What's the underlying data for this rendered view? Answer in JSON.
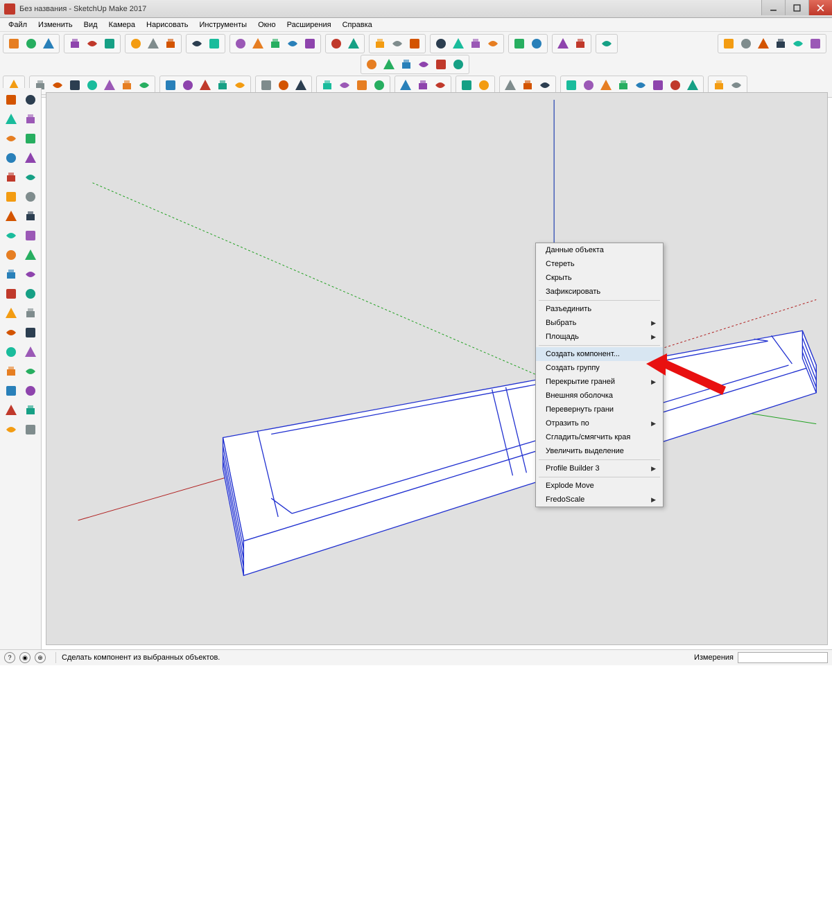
{
  "title": "Без названия - SketchUp Make 2017",
  "menu": [
    "Файл",
    "Изменить",
    "Вид",
    "Камера",
    "Нарисовать",
    "Инструменты",
    "Окно",
    "Расширения",
    "Справка"
  ],
  "toolbars": {
    "row1": {
      "g1": [
        "new-file",
        "open-file",
        "save-file"
      ],
      "g2": [
        "cut",
        "copy",
        "paste"
      ],
      "g3": [
        "delete",
        "undo",
        "redo"
      ],
      "g4": [
        "print",
        "model-info"
      ],
      "g5": [
        "component-a",
        "component-b",
        "component-c",
        "component-d",
        "component-e"
      ],
      "g6": [
        "layer-a",
        "layer-b"
      ],
      "g7": [
        "style-a",
        "style-b",
        "style-c"
      ],
      "g8": [
        "nav-a",
        "nav-b",
        "nav-c",
        "nav-d"
      ],
      "g9": [
        "misc-a",
        "misc-b"
      ],
      "g10": [
        "curve-a",
        "curve-b"
      ],
      "g11": [
        "plugin-a"
      ],
      "gRight": [
        "render-a",
        "render-b",
        "render-c",
        "render-d",
        "render-e",
        "render-f"
      ]
    },
    "row2": [
      "house-a",
      "house-b",
      "house-c",
      "house-d",
      "house-e",
      "house-f"
    ],
    "row3": {
      "g1": [
        "select"
      ],
      "g2": [
        "eraser",
        "pencil",
        "pencil-dd",
        "arc",
        "arc-dd",
        "shape",
        "shape-dd"
      ],
      "g3": [
        "push",
        "follow",
        "move",
        "rotate",
        "scale"
      ],
      "g4": [
        "tape",
        "text",
        "paint"
      ],
      "g5": [
        "orbit",
        "pan",
        "zoom",
        "zoom-ext"
      ],
      "g6": [
        "section-a",
        "section-b",
        "section-c"
      ],
      "g7": [
        "gem",
        "gem-dd"
      ],
      "g8": [
        "pb-a",
        "pb-b",
        "pb-c"
      ],
      "g9": [
        "tool-a",
        "tool-b",
        "tool-c",
        "tool-d",
        "tool-e",
        "tool-f",
        "tool-g",
        "tool-h"
      ],
      "g10": [
        "ex-a",
        "ex-b"
      ]
    }
  },
  "leftTools": [
    [
      "select",
      "component"
    ],
    [
      "paint",
      "eraser"
    ],
    [
      "line",
      "freehand"
    ],
    [
      "rect",
      "rotrect"
    ],
    [
      "circle",
      "polygon"
    ],
    [
      "arc",
      "arc2"
    ],
    [
      "pie",
      "arc3"
    ],
    [
      "move",
      "push"
    ],
    [
      "rotate",
      "follow"
    ],
    [
      "scale",
      "offset"
    ],
    [
      "tape",
      "dim"
    ],
    [
      "protractor",
      "text"
    ],
    [
      "axes",
      "3dtext"
    ],
    [
      "orbit",
      "pan"
    ],
    [
      "zoom",
      "zoomwin"
    ],
    [
      "prev",
      "zoom-ext"
    ],
    [
      "position",
      "look"
    ],
    [
      "walk",
      "section"
    ]
  ],
  "contextMenu": {
    "groups": [
      [
        {
          "label": "Данные объекта",
          "sub": false
        },
        {
          "label": "Стереть",
          "sub": false
        },
        {
          "label": "Скрыть",
          "sub": false
        },
        {
          "label": "Зафиксировать",
          "sub": false
        }
      ],
      [
        {
          "label": "Разъединить",
          "sub": false
        },
        {
          "label": "Выбрать",
          "sub": true
        },
        {
          "label": "Площадь",
          "sub": true
        }
      ],
      [
        {
          "label": "Создать компонент...",
          "sub": false,
          "hl": true
        },
        {
          "label": "Создать группу",
          "sub": false
        },
        {
          "label": "Перекрытие граней",
          "sub": true
        },
        {
          "label": "Внешняя оболочка",
          "sub": false
        },
        {
          "label": "Перевернуть грани",
          "sub": false
        },
        {
          "label": "Отразить по",
          "sub": true
        },
        {
          "label": "Сгладить/смягчить края",
          "sub": false
        },
        {
          "label": "Увеличить выделение",
          "sub": false
        }
      ],
      [
        {
          "label": "Profile Builder 3",
          "sub": true
        }
      ],
      [
        {
          "label": "Explode  Move",
          "sub": false
        },
        {
          "label": "FredoScale",
          "sub": true
        }
      ]
    ]
  },
  "status": {
    "hint": "Сделать компонент из выбранных объектов.",
    "measure_label": "Измерения"
  },
  "colors": {
    "axis_red": "#b02020",
    "axis_green": "#20a020",
    "axis_blue": "#2040b0",
    "selection": "#2030d0",
    "face": "#ffffff",
    "bg": "#e0e0e0"
  }
}
